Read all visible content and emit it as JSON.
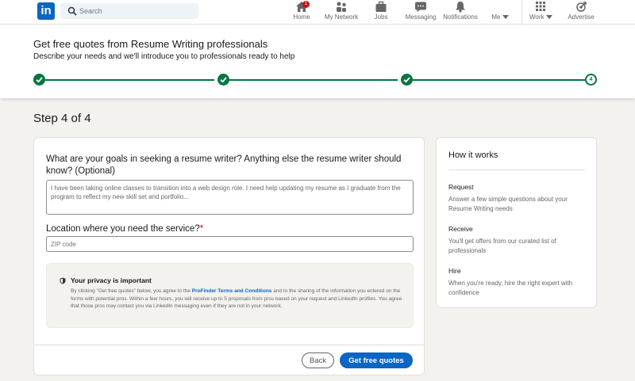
{
  "nav": {
    "logo_text": "in",
    "search_placeholder": "Search",
    "items": [
      {
        "label": "Home",
        "icon": "home-icon"
      },
      {
        "label": "My Network",
        "icon": "network-icon"
      },
      {
        "label": "Jobs",
        "icon": "jobs-icon"
      },
      {
        "label": "Messaging",
        "icon": "messaging-icon"
      },
      {
        "label": "Notifications",
        "icon": "bell-icon"
      },
      {
        "label": "Me",
        "icon": "avatar-icon"
      },
      {
        "label": "Work",
        "icon": "grid-icon"
      },
      {
        "label": "Advertise",
        "icon": "advertise-icon"
      }
    ],
    "home_badge": "1"
  },
  "header": {
    "title": "Get free quotes from Resume Writing professionals",
    "subtitle": "Describe your needs and we'll introduce you to professionals ready to help",
    "progress": {
      "total_steps": 4,
      "current_step": 4,
      "current_label": "4"
    }
  },
  "step_title": "Step 4 of 4",
  "form": {
    "goals_label": "What are your goals in seeking a resume writer? Anything else the resume writer should know? (Optional)",
    "goals_value": "I have been taking online classes to transition into a web design role. I need help updating my resume as I graduate from the program to reflect my new skill set and portfolio...",
    "location_label": "Location where you need the service?",
    "location_required": "*",
    "zip_placeholder": "ZIP code",
    "privacy": {
      "title": "Your privacy is important",
      "text_before": "By clicking \"Get free quotes\" below, you agree to the ",
      "link": "ProFinder Terms and Conditions",
      "text_after": " and to the sharing of the information you entered on the forms with potential pros. Within a few hours, you will receive up to 5 proposals from pros based on your request and LinkedIn profiles. You agree that those pros may contact you via LinkedIn messaging even if they are not in your network."
    },
    "back_label": "Back",
    "submit_label": "Get free quotes"
  },
  "how_it_works": {
    "title": "How it works",
    "steps": [
      {
        "title": "Request",
        "desc": "Answer a few simple questions about your Resume Writing needs"
      },
      {
        "title": "Receive",
        "desc": "You'll get offers from our curated list of professionals"
      },
      {
        "title": "Hire",
        "desc": "When you're ready, hire the right expert with confidence"
      }
    ]
  },
  "colors": {
    "brand": "#0a66c2",
    "success": "#057642",
    "required": "#cc1016"
  }
}
